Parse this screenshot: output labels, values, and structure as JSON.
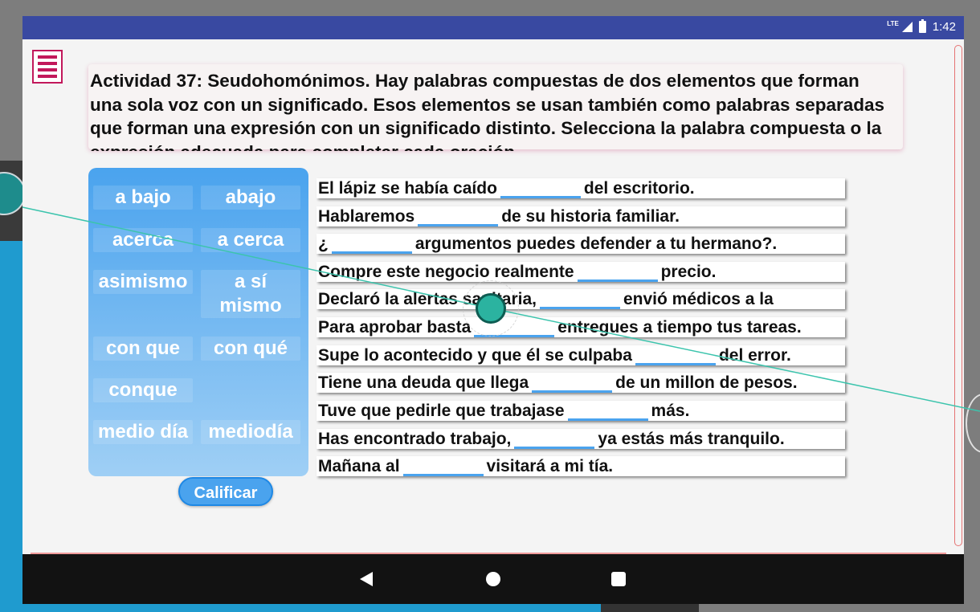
{
  "status": {
    "network": "LTE",
    "time": "1:42"
  },
  "instructions": "Actividad 37: Seudohomónimos. Hay palabras compuestas de dos elementos que forman una sola voz con un significado. Esos elementos se usan también como palabras separadas que forman una expresión con un significado distinto. Selecciona la palabra compuesta o la expresión adecuada para completar cada oración.",
  "word_bank": [
    "a bajo",
    "abajo",
    "acerca",
    "a cerca",
    "asimismo",
    "a sí mismo",
    "con que",
    "con qué",
    "conque",
    "medio día",
    "mediodía"
  ],
  "sentences": [
    {
      "before": "El lápiz se había caído",
      "after": "del escritorio."
    },
    {
      "before": "Hablaremos",
      "after": "de su historia familiar."
    },
    {
      "before": "¿",
      "after": "argumentos puedes defender a tu hermano?."
    },
    {
      "before": "Compre este negocio realmente",
      "after": "precio."
    },
    {
      "before": "Declaró la alertas sanitaria,",
      "after": "envió médicos a la"
    },
    {
      "before": "Para aprobar basta",
      "after": "entregues a tiempo tus tareas."
    },
    {
      "before": "Supe lo acontecido y que él se culpaba",
      "after": "del error."
    },
    {
      "before": "Tiene una deuda que llega",
      "after": "de un millon de pesos."
    },
    {
      "before": "Tuve que pedirle que trabajase",
      "after": "más."
    },
    {
      "before": "Has encontrado trabajo,",
      "after": "ya estás más tranquilo."
    },
    {
      "before": "Mañana al",
      "after": "visitará a mi tía."
    }
  ],
  "grade_button": "Calificar",
  "colors": {
    "status_bar": "#3949a1",
    "accent": "#c2185b",
    "bank": "#4aa3ee"
  }
}
